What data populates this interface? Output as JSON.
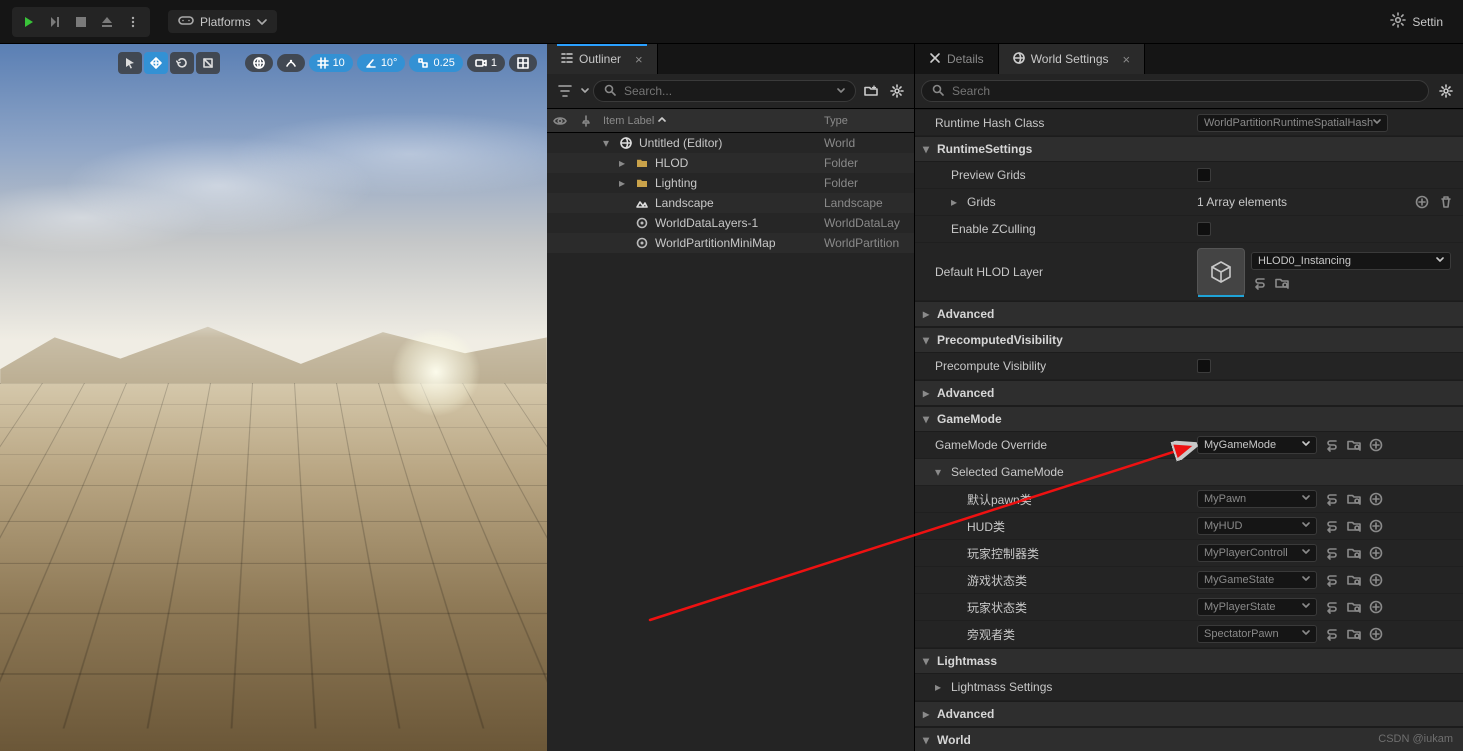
{
  "topbar": {
    "platforms_label": "Platforms",
    "settings_label": "Settin"
  },
  "viewport": {
    "snap_grid": "10",
    "snap_angle": "10°",
    "snap_scale": "0.25",
    "camera_speed": "1"
  },
  "outliner": {
    "tab_label": "Outliner",
    "search_placeholder": "Search...",
    "col_label": "Item Label",
    "col_type": "Type",
    "rows": [
      {
        "label": "Untitled (Editor)",
        "type": "World",
        "indent": 0,
        "icon": "world",
        "expand": "open"
      },
      {
        "label": "HLOD",
        "type": "Folder",
        "indent": 1,
        "icon": "folder",
        "expand": "closed"
      },
      {
        "label": "Lighting",
        "type": "Folder",
        "indent": 1,
        "icon": "folder",
        "expand": "closed"
      },
      {
        "label": "Landscape",
        "type": "Landscape",
        "indent": 1,
        "icon": "landscape",
        "expand": ""
      },
      {
        "label": "WorldDataLayers-1",
        "type": "WorldDataLay",
        "indent": 1,
        "icon": "actor",
        "expand": ""
      },
      {
        "label": "WorldPartitionMiniMap",
        "type": "WorldPartition",
        "indent": 1,
        "icon": "actor",
        "expand": ""
      }
    ]
  },
  "details": {
    "tab_details": "Details",
    "tab_world": "World Settings",
    "search_placeholder": "Search",
    "runtime_hash_label": "Runtime Hash Class",
    "runtime_hash_value": "WorldPartitionRuntimeSpatialHash",
    "cat_runtime": "RuntimeSettings",
    "preview_grids": "Preview Grids",
    "grids": "Grids",
    "grids_value": "1 Array elements",
    "enable_zcull": "Enable ZCulling",
    "default_hlod": "Default HLOD Layer",
    "default_hlod_value": "HLOD0_Instancing",
    "advanced": "Advanced",
    "cat_precomp": "PrecomputedVisibility",
    "precompute_vis": "Precompute Visibility",
    "cat_gamemode": "GameMode",
    "gamemode_override": "GameMode Override",
    "gamemode_override_value": "MyGameMode",
    "selected_gamemode": "Selected GameMode",
    "gm_rows": [
      {
        "label": "默认pawn类",
        "value": "MyPawn"
      },
      {
        "label": "HUD类",
        "value": "MyHUD"
      },
      {
        "label": "玩家控制器类",
        "value": "MyPlayerControll"
      },
      {
        "label": "游戏状态类",
        "value": "MyGameState"
      },
      {
        "label": "玩家状态类",
        "value": "MyPlayerState"
      },
      {
        "label": "旁观者类",
        "value": "SpectatorPawn"
      }
    ],
    "cat_lightmass": "Lightmass",
    "lightmass_settings": "Lightmass Settings",
    "cat_world": "World"
  },
  "watermark": "CSDN @iukam"
}
